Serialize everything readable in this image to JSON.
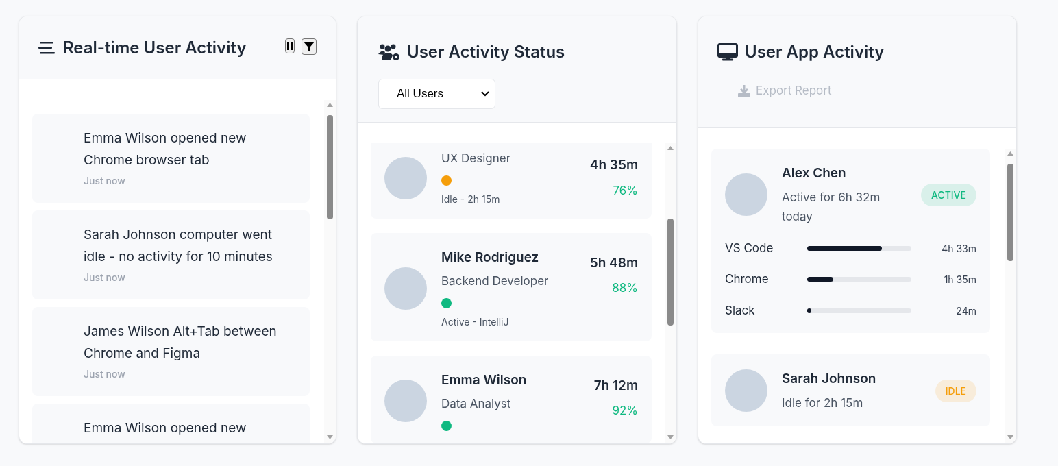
{
  "feed": {
    "title": "Real-time User Activity",
    "events": [
      {
        "text": "Emma Wilson opened new Chrome browser tab",
        "time": "Just now"
      },
      {
        "text": "Sarah Johnson computer went idle - no activity for 10 minutes",
        "time": "Just now"
      },
      {
        "text": "James Wilson Alt+Tab between Chrome and Figma",
        "time": "Just now"
      },
      {
        "text": "Emma Wilson opened new"
      }
    ]
  },
  "status": {
    "title": "User Activity Status",
    "filter": "All Users",
    "users": [
      {
        "role": "UX Designer",
        "color": "#f59e0b",
        "detail": "Idle - 2h 15m",
        "time": "4h 35m",
        "percent": "76%"
      },
      {
        "name": "Mike Rodriguez",
        "role": "Backend Developer",
        "color": "#10b981",
        "detail": "Active - IntelliJ",
        "time": "5h 48m",
        "percent": "88%"
      },
      {
        "name": "Emma Wilson",
        "role": "Data Analyst",
        "color": "#10b981",
        "time": "7h 12m",
        "percent": "92%"
      }
    ]
  },
  "apps": {
    "title": "User App Activity",
    "export_label": "Export Report",
    "users": [
      {
        "name": "Alex Chen",
        "summary": "Active for 6h 32m today",
        "badge": "ACTIVE",
        "color": "#10b981",
        "apps": [
          {
            "name": "VS Code",
            "level": 0.72,
            "time": "4h 33m"
          },
          {
            "name": "Chrome",
            "level": 0.25,
            "time": "1h 35m"
          },
          {
            "name": "Slack",
            "level": 0.04,
            "time": "24m"
          }
        ]
      },
      {
        "name": "Sarah Johnson",
        "summary": "Idle for 2h 15m",
        "badge": "IDLE",
        "color": "#f59e0b"
      }
    ]
  }
}
